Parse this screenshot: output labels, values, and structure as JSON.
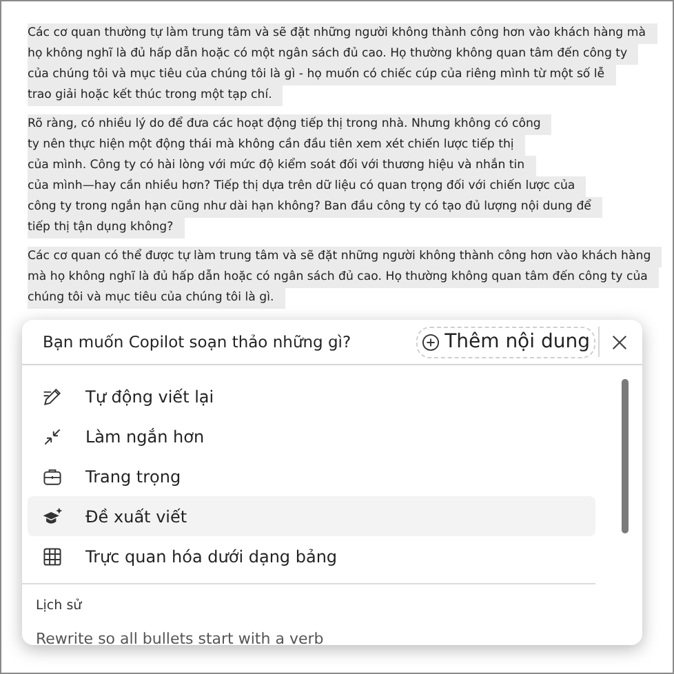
{
  "document": {
    "paragraphs": [
      {
        "lines": [
          "Các cơ quan thường tự làm trung tâm và sẽ đặt những người không thành công hơn vào khách hàng mà",
          "họ không nghĩ là đủ hấp dẫn hoặc có một ngân sách đủ cao. Họ thường không quan tâm đến công ty",
          "của chúng tôi và mục tiêu của chúng tôi là gì - họ muốn có chiếc cúp của riêng mình từ một số lễ",
          "trao giải hoặc kết thúc trong một tạp chí."
        ]
      },
      {
        "lines": [
          "Rõ ràng, có nhiều lý do để đưa các hoạt động tiếp thị trong nhà. Nhưng không có công",
          "ty nên thực hiện một động thái mà không cần đầu tiên xem xét chiến lược tiếp thị",
          "của mình. Công ty có hài lòng với mức độ kiểm soát đối với thương hiệu và nhắn tin",
          "của mình—hay cần nhiều hơn? Tiếp thị dựa trên dữ liệu có quan trọng đối với chiến lược của",
          "công ty trong ngắn hạn cũng như dài hạn không? Ban đầu công ty có tạo đủ lượng nội dung để",
          "tiếp thị tận dụng không?"
        ]
      },
      {
        "lines": [
          "Các cơ quan có thể được tự làm trung tâm và sẽ đặt những người không thành công hơn vào khách hàng",
          "mà họ không nghĩ là đủ hấp dẫn hoặc có ngân sách đủ cao. Họ thường không quan tâm đến công ty của",
          "chúng tôi và mục tiêu của chúng tôi là gì."
        ]
      }
    ]
  },
  "copilot_panel": {
    "prompt": "Bạn muốn Copilot soạn thảo những gì?",
    "add_content_button": "Thêm nội dung",
    "menu_items": [
      {
        "kind": "rewrite",
        "label": "Tự động viết lại",
        "selected": false
      },
      {
        "kind": "shorten",
        "label": "Làm ngắn hơn",
        "selected": false
      },
      {
        "kind": "formal",
        "label": "Trang trọng",
        "selected": false
      },
      {
        "kind": "suggest",
        "label": "Đề xuất viết",
        "selected": true
      },
      {
        "kind": "table",
        "label": "Trực quan hóa dưới dạng bảng",
        "selected": false
      }
    ],
    "history_heading": "Lịch sử",
    "history_items": [
      "Rewrite so all bullets start with a verb"
    ]
  }
}
